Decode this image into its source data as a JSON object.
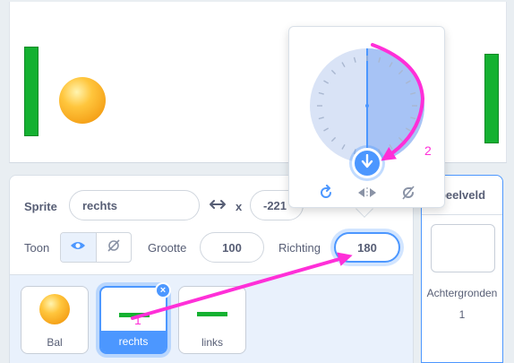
{
  "sprite_info": {
    "sprite_label": "Sprite",
    "sprite_name": "rechts",
    "x_label": "x",
    "x_value": "-221",
    "show_label": "Toon",
    "size_label": "Grootte",
    "size_value": "100",
    "direction_label": "Richting",
    "direction_value": "180"
  },
  "sprites": [
    {
      "name": "Bal"
    },
    {
      "name": "rechts"
    },
    {
      "name": "links"
    }
  ],
  "stage_panel": {
    "title": "peelveld",
    "backdrops_label": "Achtergronden",
    "backdrops_count": "1"
  },
  "annotations": {
    "step1": "1",
    "step2": "2"
  },
  "colors": {
    "accent": "#4c97ff",
    "annotation": "#ff2fd8",
    "paddle": "#14b131",
    "ball": "#ffb21f"
  }
}
